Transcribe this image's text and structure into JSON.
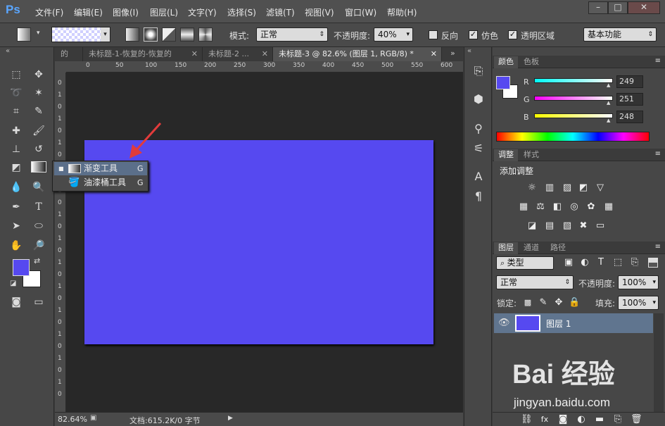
{
  "app": {
    "logo": "Ps"
  },
  "menu": [
    "文件(F)",
    "编辑(E)",
    "图像(I)",
    "图层(L)",
    "文字(Y)",
    "选择(S)",
    "滤镜(T)",
    "视图(V)",
    "窗口(W)",
    "帮助(H)"
  ],
  "window_buttons": [
    "–",
    "□",
    "✕"
  ],
  "options": {
    "mode_label": "模式:",
    "mode_value": "正常",
    "opacity_label": "不透明度:",
    "opacity_value": "40%",
    "reverse_label": "反向",
    "dither_label": "仿色",
    "transparency_label": "透明区域",
    "workspace_value": "基本功能"
  },
  "tabs": [
    {
      "label": "的"
    },
    {
      "label": "未标题-1-恢复的-恢复的"
    },
    {
      "label": "未标题-2 ..."
    },
    {
      "label": "未标题-3 @ 82.6% (图层 1, RGB/8) *"
    }
  ],
  "ruler_h": [
    "0",
    "50",
    "100",
    "150",
    "200",
    "250",
    "300",
    "350",
    "400",
    "450",
    "500",
    "550",
    "600"
  ],
  "ruler_v": [
    "0",
    "1",
    "0",
    "1",
    "0",
    "1",
    "0",
    "1",
    "0",
    "1",
    "0",
    "1",
    "0",
    "1",
    "0",
    "1",
    "0",
    "1",
    "0",
    "1",
    "0",
    "1",
    "0",
    "1",
    "0",
    "1",
    "0"
  ],
  "status": {
    "zoom": "82.64%",
    "doc": "文档:615.2K/0 字节"
  },
  "flyout": {
    "items": [
      {
        "label": "渐变工具",
        "key": "G"
      },
      {
        "label": "油漆桶工具",
        "key": "G"
      }
    ]
  },
  "color_panel": {
    "tabs": [
      "颜色",
      "色板"
    ],
    "channels": [
      {
        "label": "R",
        "value": "249"
      },
      {
        "label": "G",
        "value": "251"
      },
      {
        "label": "B",
        "value": "248"
      }
    ],
    "fg": "#5649f0",
    "bg": "#ffffff"
  },
  "adjust_panel": {
    "tabs": [
      "调整",
      "样式"
    ],
    "title": "添加调整"
  },
  "layers_panel": {
    "tabs": [
      "图层",
      "通道",
      "路径"
    ],
    "filter_label": "类型",
    "blend_value": "正常",
    "opacity_label": "不透明度:",
    "opacity_value": "100%",
    "lock_label": "锁定:",
    "fill_label": "填充:",
    "fill_value": "100%",
    "layers": [
      {
        "name": "图层 1"
      }
    ]
  },
  "watermark": {
    "text": "Bai 经验",
    "url": "jingyan.baidu.com"
  },
  "colors": {
    "canvas": "#5649f0",
    "accent": "#5aa6ff"
  }
}
